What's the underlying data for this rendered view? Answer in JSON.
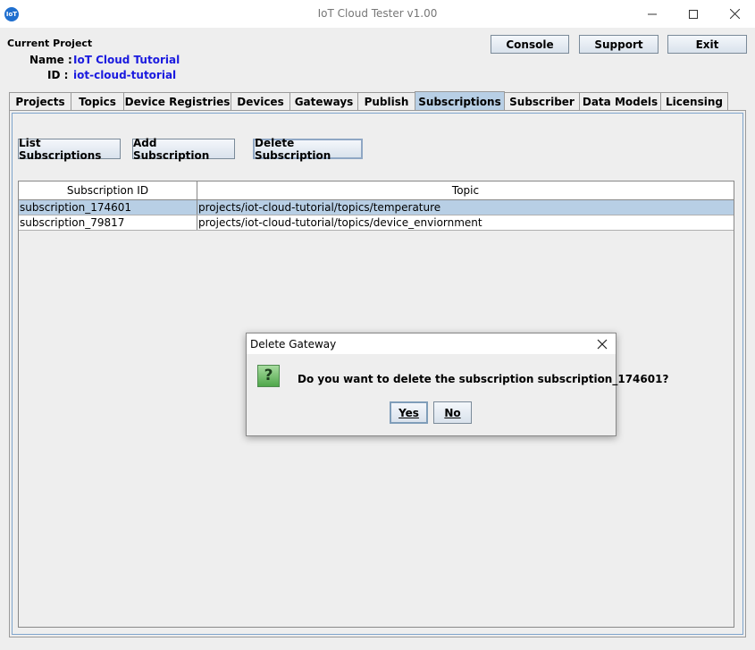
{
  "window": {
    "title": "IoT Cloud Tester v1.00",
    "icon": "iot-app-icon",
    "app_icon_text": "IoT"
  },
  "project": {
    "heading": "Current Project",
    "name_label": "Name :",
    "name_value": "IoT Cloud Tutorial",
    "id_label": "ID :",
    "id_value": "iot-cloud-tutorial"
  },
  "top_buttons": {
    "console": "Console",
    "support": "Support",
    "exit": "Exit"
  },
  "tabs": [
    {
      "label": "Projects"
    },
    {
      "label": "Topics"
    },
    {
      "label": "Device Registries"
    },
    {
      "label": "Devices"
    },
    {
      "label": "Gateways"
    },
    {
      "label": "Publish"
    },
    {
      "label": "Subscriptions",
      "selected": true
    },
    {
      "label": "Subscriber"
    },
    {
      "label": "Data Models"
    },
    {
      "label": "Licensing"
    }
  ],
  "actions": {
    "list": "List Subscriptions",
    "add": "Add Subscription",
    "delete": "Delete Subscription"
  },
  "table": {
    "headers": [
      "Subscription ID",
      "Topic"
    ],
    "rows": [
      {
        "id": "subscription_174601",
        "topic": "projects/iot-cloud-tutorial/topics/temperature",
        "selected": true
      },
      {
        "id": "subscription_79817",
        "topic": "projects/iot-cloud-tutorial/topics/device_enviornment",
        "selected": false
      }
    ]
  },
  "dialog": {
    "title": "Delete Gateway",
    "icon": "question-icon",
    "icon_glyph": "?",
    "message": "Do you want to delete the subscription subscription_174601?",
    "yes": "Yes",
    "no": "No"
  },
  "colors": {
    "accent_selected": "#b8cfe5",
    "project_value": "#1a1adf"
  }
}
